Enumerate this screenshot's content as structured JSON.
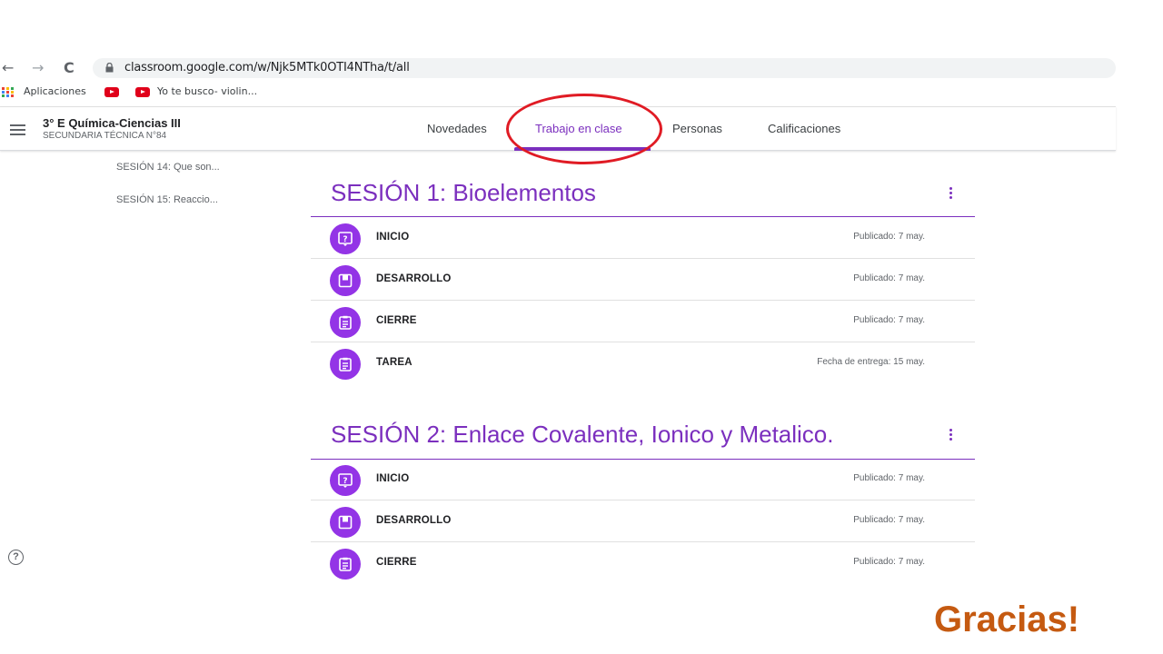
{
  "browser": {
    "back_icon": "←",
    "forward_icon": "→",
    "reload_icon": "C",
    "url": "classroom.google.com/w/Njk5MTk0OTI4NTha/t/all"
  },
  "bookmarks": [
    {
      "label": "Aplicaciones",
      "icon": "apps-grid-icon"
    },
    {
      "label": "",
      "icon": "youtube-icon"
    },
    {
      "label": "Yo te busco- violin...",
      "icon": "youtube-icon"
    }
  ],
  "header": {
    "class_name": "3° E Química-Ciencias III",
    "school": "SECUNDARIA TÉCNICA N°84",
    "tabs": [
      {
        "label": "Novedades",
        "active": false
      },
      {
        "label": "Trabajo en clase",
        "active": true
      },
      {
        "label": "Personas",
        "active": false
      },
      {
        "label": "Calificaciones",
        "active": false
      }
    ]
  },
  "sidebar": {
    "items": [
      {
        "label": "SESIÓN 14: Que son..."
      },
      {
        "label": "SESIÓN 15: Reaccio..."
      }
    ]
  },
  "topics": [
    {
      "title": "SESIÓN 1: Bioelementos",
      "items": [
        {
          "label": "INICIO",
          "date": "Publicado: 7 may.",
          "icon": "question-icon"
        },
        {
          "label": "DESARROLLO",
          "date": "Publicado: 7 may.",
          "icon": "material-icon"
        },
        {
          "label": "CIERRE",
          "date": "Publicado: 7 may.",
          "icon": "assignment-icon"
        },
        {
          "label": "TAREA",
          "date": "Fecha de entrega: 15 may.",
          "icon": "assignment-icon"
        }
      ]
    },
    {
      "title": "SESIÓN 2: Enlace Covalente, Ionico y Metalico.",
      "items": [
        {
          "label": "INICIO",
          "date": "Publicado: 7 may.",
          "icon": "question-icon"
        },
        {
          "label": "DESARROLLO",
          "date": "Publicado: 7 may.",
          "icon": "material-icon"
        },
        {
          "label": "CIERRE",
          "date": "Publicado: 7 may.",
          "icon": "assignment-icon"
        }
      ]
    }
  ],
  "help_icon": "?",
  "footer_text": "Gracias!",
  "colors": {
    "accent": "#7b2fbe",
    "icon_bg": "#9334e6",
    "highlight_circle": "#e01b24",
    "gracias": "#c55a11"
  }
}
